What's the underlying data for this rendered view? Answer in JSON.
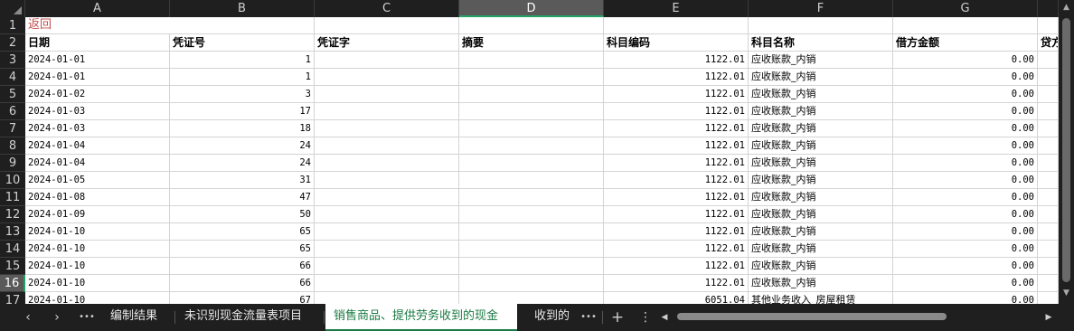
{
  "columns": [
    "A",
    "B",
    "C",
    "D",
    "E",
    "F",
    "G",
    ""
  ],
  "rows": [
    1,
    2,
    3,
    4,
    5,
    6,
    7,
    8,
    9,
    10,
    11,
    12,
    13,
    14,
    15,
    16,
    17
  ],
  "back_link": "返回",
  "headers": {
    "date": "日期",
    "voucher_no": "凭证号",
    "voucher_word": "凭证字",
    "summary": "摘要",
    "account_code": "科目编码",
    "account_name": "科目名称",
    "debit": "借方金额",
    "credit": "贷方"
  },
  "data_rows": [
    {
      "date": "2024-01-01",
      "voucher_no": "1",
      "account_code": "1122.01",
      "account_name": "应收账款_内销",
      "debit": "0.00",
      "credit": ""
    },
    {
      "date": "2024-01-01",
      "voucher_no": "1",
      "account_code": "1122.01",
      "account_name": "应收账款_内销",
      "debit": "0.00",
      "credit": ""
    },
    {
      "date": "2024-01-02",
      "voucher_no": "3",
      "account_code": "1122.01",
      "account_name": "应收账款_内销",
      "debit": "0.00",
      "credit": ""
    },
    {
      "date": "2024-01-03",
      "voucher_no": "17",
      "account_code": "1122.01",
      "account_name": "应收账款_内销",
      "debit": "0.00",
      "credit": ""
    },
    {
      "date": "2024-01-03",
      "voucher_no": "18",
      "account_code": "1122.01",
      "account_name": "应收账款_内销",
      "debit": "0.00",
      "credit": ""
    },
    {
      "date": "2024-01-04",
      "voucher_no": "24",
      "account_code": "1122.01",
      "account_name": "应收账款_内销",
      "debit": "0.00",
      "credit": ""
    },
    {
      "date": "2024-01-04",
      "voucher_no": "24",
      "account_code": "1122.01",
      "account_name": "应收账款_内销",
      "debit": "0.00",
      "credit": ""
    },
    {
      "date": "2024-01-05",
      "voucher_no": "31",
      "account_code": "1122.01",
      "account_name": "应收账款_内销",
      "debit": "0.00",
      "credit": ""
    },
    {
      "date": "2024-01-08",
      "voucher_no": "47",
      "account_code": "1122.01",
      "account_name": "应收账款_内销",
      "debit": "0.00",
      "credit": ""
    },
    {
      "date": "2024-01-09",
      "voucher_no": "50",
      "account_code": "1122.01",
      "account_name": "应收账款_内销",
      "debit": "0.00",
      "credit": ""
    },
    {
      "date": "2024-01-10",
      "voucher_no": "65",
      "account_code": "1122.01",
      "account_name": "应收账款_内销",
      "debit": "0.00",
      "credit": ""
    },
    {
      "date": "2024-01-10",
      "voucher_no": "65",
      "account_code": "1122.01",
      "account_name": "应收账款_内销",
      "debit": "0.00",
      "credit": ""
    },
    {
      "date": "2024-01-10",
      "voucher_no": "66",
      "account_code": "1122.01",
      "account_name": "应收账款_内销",
      "debit": "0.00",
      "credit": ""
    },
    {
      "date": "2024-01-10",
      "voucher_no": "66",
      "account_code": "1122.01",
      "account_name": "应收账款_内销",
      "debit": "0.00",
      "credit": ""
    },
    {
      "date": "2024-01-10",
      "voucher_no": "67",
      "account_code": "6051.04",
      "account_name": "其他业务收入_房屋租赁",
      "debit": "0.00",
      "credit": ""
    }
  ],
  "selected_column": "D",
  "selected_row": 16,
  "sheet_tabs": {
    "prev_icon": "chevron-left-icon",
    "next_icon": "chevron-right-icon",
    "more_left": "•••",
    "tabs": [
      "编制结果",
      "未识别现金流量表项目",
      "销售商品、提供劳务收到的现金",
      "收到的"
    ],
    "active_index": 2,
    "more_right": "•••",
    "add": "+",
    "options": "⋮"
  },
  "colors": {
    "accent": "#21a366",
    "back_link": "#c0504d",
    "chrome": "#1f1f1f"
  }
}
